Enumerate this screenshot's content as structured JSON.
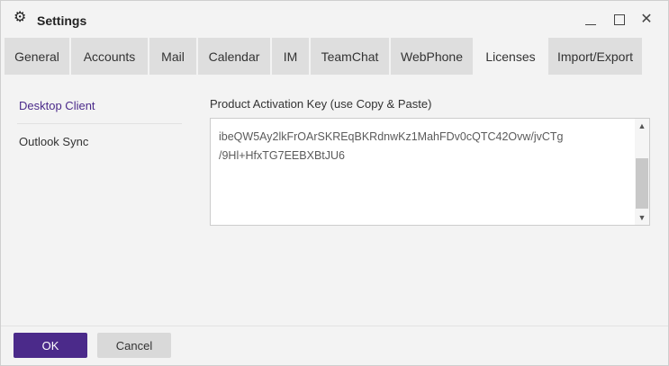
{
  "window": {
    "title": "Settings",
    "icon": "gear-icon"
  },
  "tabs": [
    {
      "label": "General",
      "active": false
    },
    {
      "label": "Accounts",
      "active": false
    },
    {
      "label": "Mail",
      "active": false
    },
    {
      "label": "Calendar",
      "active": false
    },
    {
      "label": "IM",
      "active": false
    },
    {
      "label": "TeamChat",
      "active": false
    },
    {
      "label": "WebPhone",
      "active": false
    },
    {
      "label": "Licenses",
      "active": true
    },
    {
      "label": "Import/Export",
      "active": false
    }
  ],
  "subnav": {
    "items": [
      {
        "label": "Desktop Client",
        "active": true
      },
      {
        "label": "Outlook Sync",
        "active": false
      }
    ]
  },
  "activation": {
    "label": "Product Activation Key (use Copy & Paste)",
    "line1": "ibeQW5Ay2lkFrOArSKREqBKRdnwKz1MahFDv0cQTC42Ovw/jvCTg",
    "line2": "/9Hl+HfxTG7EEBXBtJU6"
  },
  "footer": {
    "ok_label": "OK",
    "cancel_label": "Cancel"
  },
  "colors": {
    "accent": "#4b2a8a"
  }
}
